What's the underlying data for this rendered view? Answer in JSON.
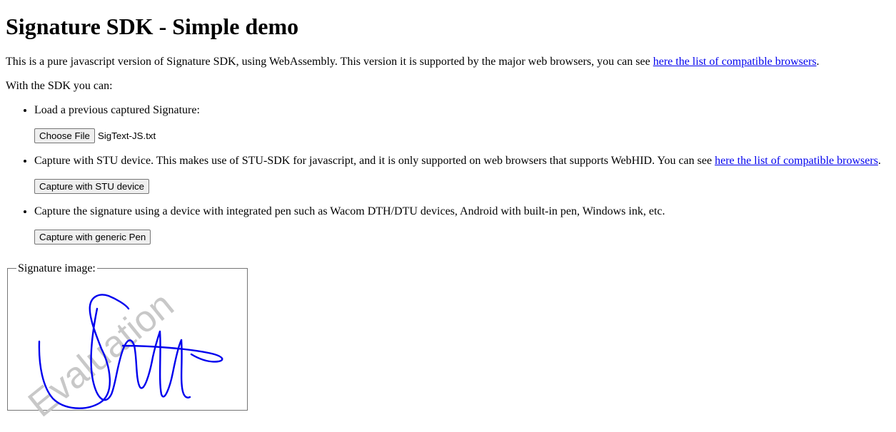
{
  "page": {
    "title": "Signature SDK - Simple demo",
    "intro_text": "This is a pure javascript version of Signature SDK, using WebAssembly. This version it is supported by the major web browsers, you can see ",
    "intro_link": "here the list of compatible browsers",
    "intro_end": ".",
    "with_sdk": "With the SDK you can:"
  },
  "options": {
    "load": {
      "text": "Load a previous captured Signature:",
      "button": "Choose File",
      "file_name": "SigText-JS.txt"
    },
    "stu": {
      "text": "Capture with STU device. This makes use of STU-SDK for javascript, and it is only supported on web browsers that supports WebHID. You can see ",
      "link": "here the list of compatible browsers",
      "text_end": ".",
      "button": "Capture with STU device"
    },
    "pen": {
      "text": "Capture the signature using a device with integrated pen such as Wacom DTH/DTU devices, Android with built-in pen, Windows ink, etc.",
      "button": "Capture with generic Pen"
    }
  },
  "signature": {
    "legend": "Signature image:",
    "watermark": "Evaluation",
    "ink_color": "#0000ee",
    "watermark_color": "#c8c8c8"
  }
}
